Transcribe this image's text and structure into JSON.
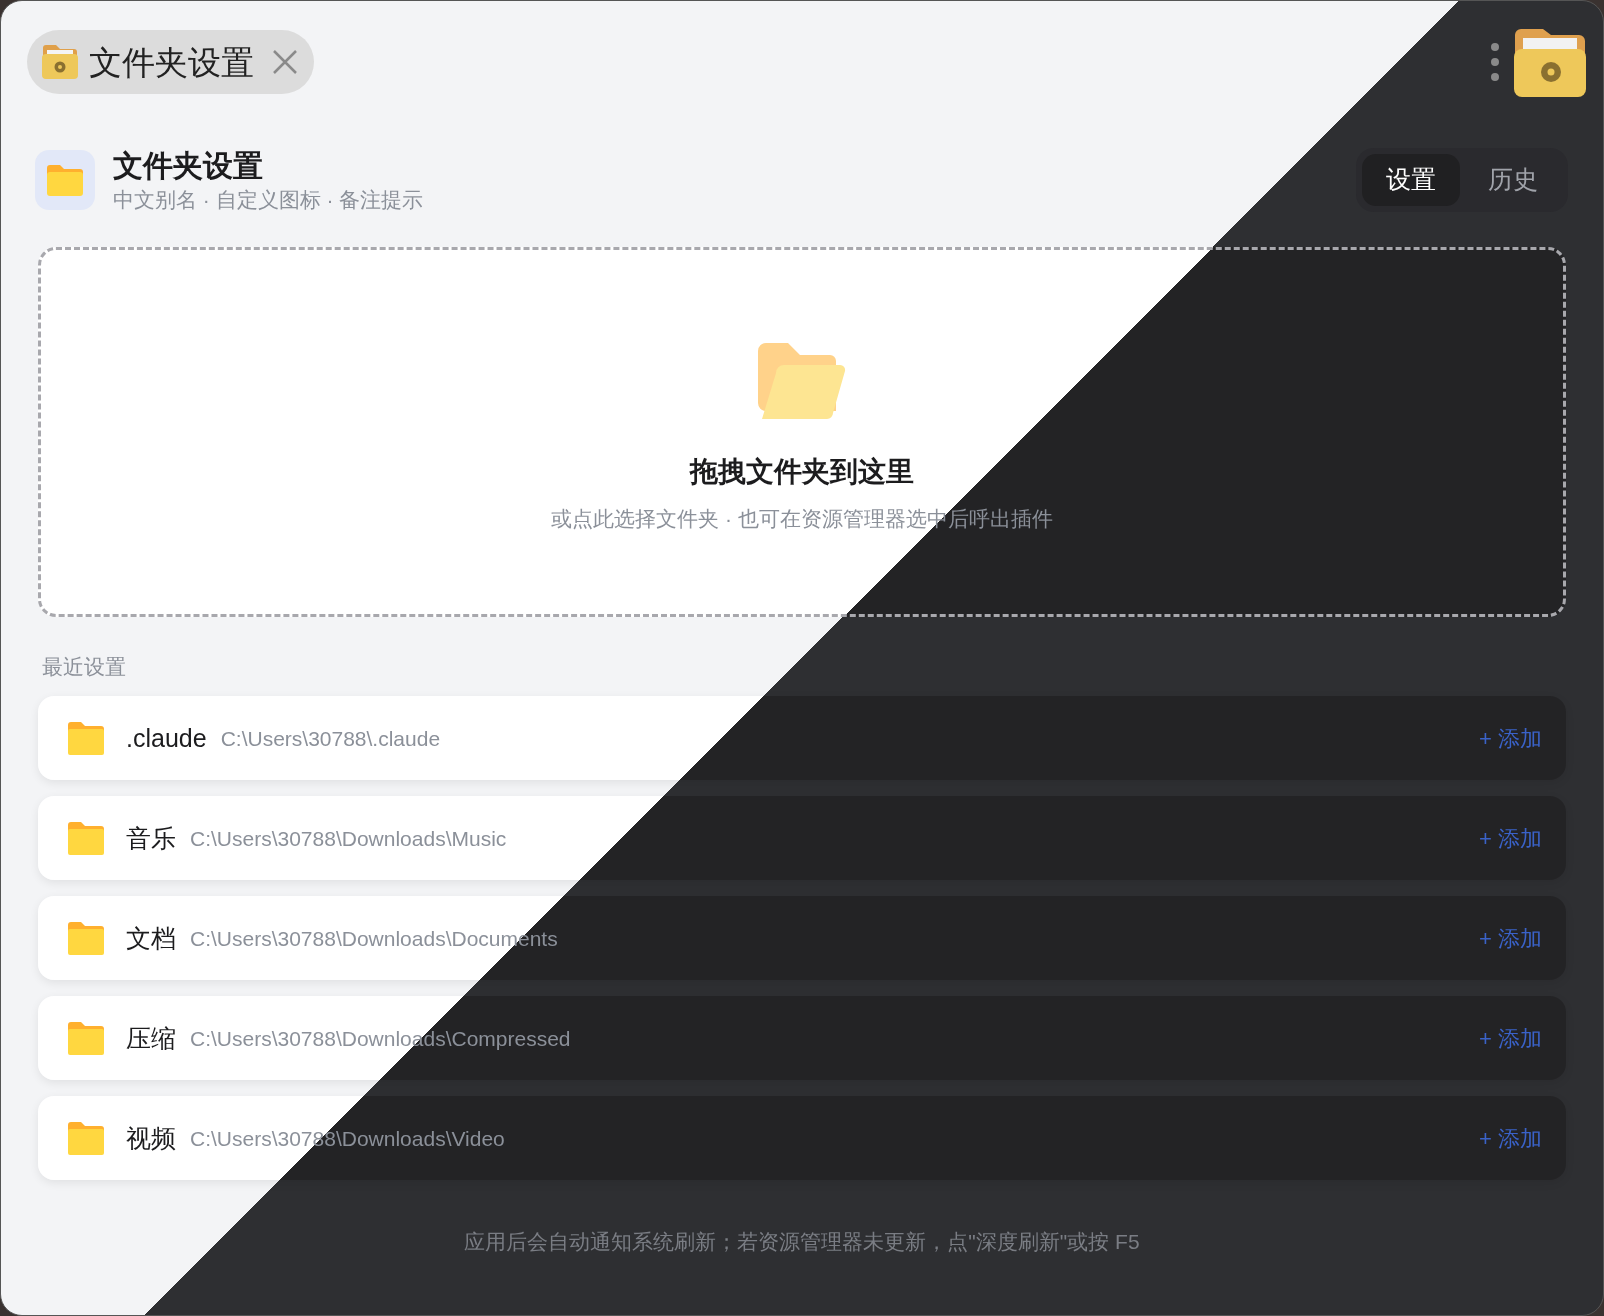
{
  "title_chip": {
    "title": "文件夹设置"
  },
  "header": {
    "title": "文件夹设置",
    "subtitle": "中文别名 · 自定义图标 · 备注提示"
  },
  "tabs": [
    {
      "label": "设置",
      "selected": true
    },
    {
      "label": "历史",
      "selected": false
    }
  ],
  "drop_zone": {
    "title": "拖拽文件夹到这里",
    "hint": "或点此选择文件夹 · 也可在资源管理器选中后呼出插件"
  },
  "recent": {
    "label": "最近设置",
    "items": [
      {
        "name": ".claude",
        "path": "C:\\Users\\30788\\.claude",
        "action": "+ 添加"
      },
      {
        "name": "音乐",
        "path": "C:\\Users\\30788\\Downloads\\Music",
        "action": "+ 添加"
      },
      {
        "name": "文档",
        "path": "C:\\Users\\30788\\Downloads\\Documents",
        "action": "+ 添加"
      },
      {
        "name": "压缩",
        "path": "C:\\Users\\30788\\Downloads\\Compressed",
        "action": "+ 添加"
      },
      {
        "name": "视频",
        "path": "C:\\Users\\30788\\Downloads\\Video",
        "action": "+ 添加"
      }
    ]
  },
  "footer": "应用后会自动通知系统刷新；若资源管理器未更新，点\"深度刷新\"或按 F5"
}
